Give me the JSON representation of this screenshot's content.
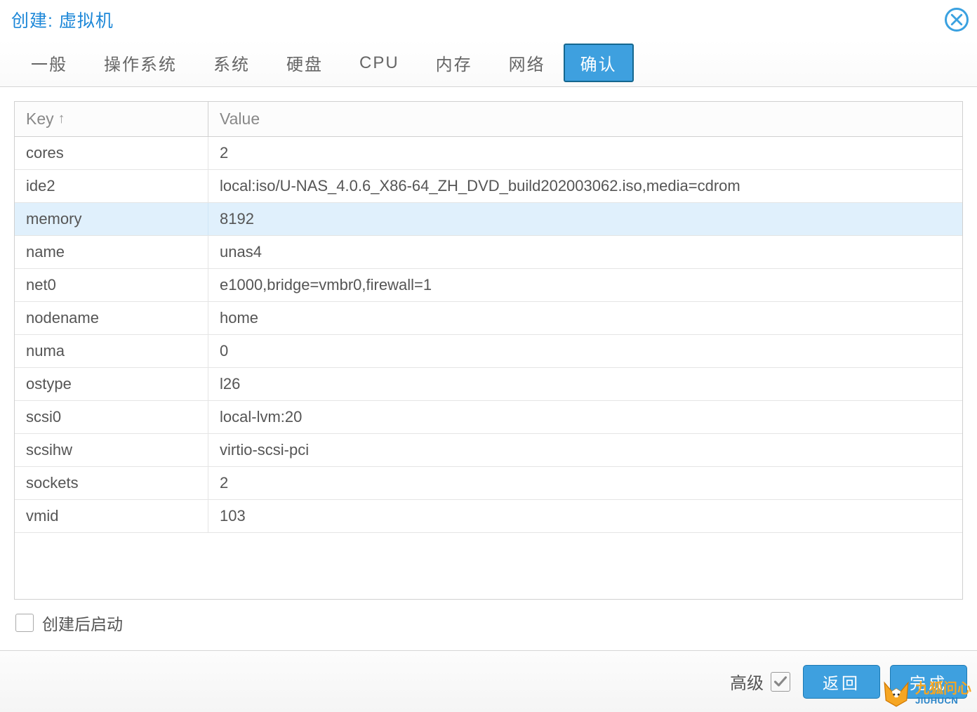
{
  "title": "创建: 虚拟机",
  "tabs": [
    {
      "label": "一般"
    },
    {
      "label": "操作系统"
    },
    {
      "label": "系统"
    },
    {
      "label": "硬盘"
    },
    {
      "label": "CPU"
    },
    {
      "label": "内存"
    },
    {
      "label": "网络"
    },
    {
      "label": "确认",
      "active": true
    }
  ],
  "grid": {
    "header_key": "Key",
    "header_value": "Value",
    "sort_indicator": "↑",
    "rows": [
      {
        "key": "cores",
        "value": "2"
      },
      {
        "key": "ide2",
        "value": "local:iso/U-NAS_4.0.6_X86-64_ZH_DVD_build202003062.iso,media=cdrom"
      },
      {
        "key": "memory",
        "value": "8192",
        "highlight": true
      },
      {
        "key": "name",
        "value": "unas4"
      },
      {
        "key": "net0",
        "value": "e1000,bridge=vmbr0,firewall=1"
      },
      {
        "key": "nodename",
        "value": "home"
      },
      {
        "key": "numa",
        "value": "0"
      },
      {
        "key": "ostype",
        "value": "l26"
      },
      {
        "key": "scsi0",
        "value": "local-lvm:20"
      },
      {
        "key": "scsihw",
        "value": "virtio-scsi-pci"
      },
      {
        "key": "sockets",
        "value": "2"
      },
      {
        "key": "vmid",
        "value": "103"
      }
    ]
  },
  "start_after_label": "创建后启动",
  "footer": {
    "advanced_label": "高级",
    "advanced_checked": true,
    "back_label": "返回",
    "finish_label": "完成"
  },
  "watermark": {
    "line1": "九狐问心",
    "line2": "JIUHUCN"
  }
}
